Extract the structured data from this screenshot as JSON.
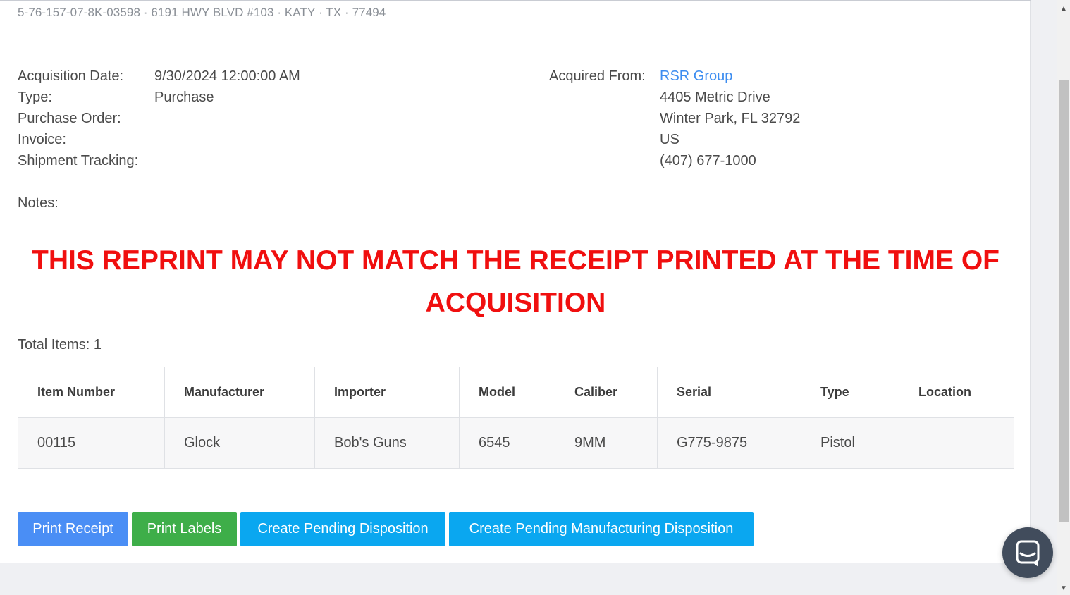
{
  "header": {
    "license_line": "5-76-157-07-8K-03598 · 6191 HWY BLVD #103 · KATY · TX · 77494"
  },
  "acquisition": {
    "labels": {
      "date": "Acquisition Date:",
      "type": "Type:",
      "purchase_order": "Purchase Order:",
      "invoice": "Invoice:",
      "shipment_tracking": "Shipment Tracking:",
      "notes": "Notes:"
    },
    "values": {
      "date": "9/30/2024 12:00:00 AM",
      "type": "Purchase"
    }
  },
  "vendor": {
    "label": "Acquired From:",
    "name": "RSR Group",
    "address1": "4405 Metric Drive",
    "address2": "Winter Park, FL 32792",
    "country": "US",
    "phone": "(407) 677-1000"
  },
  "notice": {
    "line1": "THIS REPRINT MAY NOT MATCH THE RECEIPT PRINTED AT THE TIME OF",
    "line2": "ACQUISITION"
  },
  "items": {
    "total_label": "Total Items: 1",
    "columns": [
      "Item Number",
      "Manufacturer",
      "Importer",
      "Model",
      "Caliber",
      "Serial",
      "Type",
      "Location"
    ],
    "rows": [
      [
        "00115",
        "Glock",
        "Bob's Guns",
        "6545",
        "9MM",
        "G775-9875",
        "Pistol",
        ""
      ]
    ]
  },
  "actions": {
    "print_receipt": "Print Receipt",
    "print_labels": "Print Labels",
    "create_pending_disposition": "Create Pending Disposition",
    "create_pending_manufacturing_disposition": "Create Pending Manufacturing Disposition"
  },
  "colors": {
    "link": "#3d8df0",
    "notice": "#f00f0f",
    "print_receipt_bg": "#4a8ef5",
    "print_labels_bg": "#3eae49",
    "disposition_bg": "#0aa7f0",
    "chat_bg": "#414c5c"
  },
  "icons": {
    "chat": "chat-bubble-icon",
    "scroll_up": "scroll-up-arrow-icon",
    "scroll_down": "scroll-down-arrow-icon"
  }
}
